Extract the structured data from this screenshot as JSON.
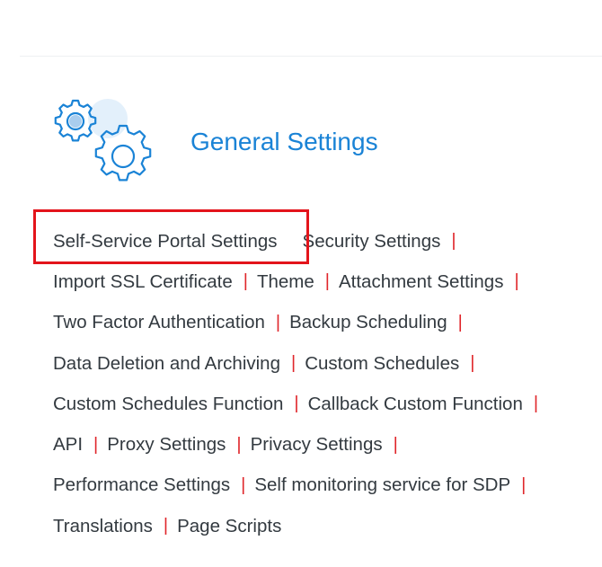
{
  "header": {
    "title": "General Settings",
    "icon": "gears-icon",
    "accent_color": "#1a83d6"
  },
  "highlight_color": "#e3141b",
  "separator": "|",
  "rows": [
    {
      "items": [
        {
          "label": "Self-Service Portal Settings",
          "name": "link-self-service-portal-settings",
          "sep": false
        },
        {
          "label": "Security Settings",
          "name": "link-security-settings",
          "sep": true
        }
      ]
    },
    {
      "items": [
        {
          "label": "Import SSL Certificate",
          "name": "link-import-ssl-certificate",
          "sep": true
        },
        {
          "label": "Theme",
          "name": "link-theme",
          "sep": true
        },
        {
          "label": "Attachment Settings",
          "name": "link-attachment-settings",
          "sep": true
        }
      ]
    },
    {
      "items": [
        {
          "label": "Two Factor Authentication",
          "name": "link-two-factor-authentication",
          "sep": true
        },
        {
          "label": "Backup Scheduling",
          "name": "link-backup-scheduling",
          "sep": true
        }
      ]
    },
    {
      "items": [
        {
          "label": "Data Deletion and Archiving",
          "name": "link-data-deletion-and-archiving",
          "sep": true
        },
        {
          "label": "Custom Schedules",
          "name": "link-custom-schedules",
          "sep": true
        }
      ]
    },
    {
      "items": [
        {
          "label": "Custom Schedules Function",
          "name": "link-custom-schedules-function",
          "sep": true
        },
        {
          "label": "Callback Custom Function",
          "name": "link-callback-custom-function",
          "sep": true
        }
      ]
    },
    {
      "items": [
        {
          "label": "API",
          "name": "link-api",
          "sep": true
        },
        {
          "label": "Proxy Settings",
          "name": "link-proxy-settings",
          "sep": true
        },
        {
          "label": "Privacy Settings",
          "name": "link-privacy-settings",
          "sep": true
        }
      ]
    },
    {
      "items": [
        {
          "label": "Performance Settings",
          "name": "link-performance-settings",
          "sep": true
        },
        {
          "label": "Self monitoring service for SDP",
          "name": "link-self-monitoring-service-for-sdp",
          "sep": true
        }
      ]
    },
    {
      "items": [
        {
          "label": "Translations",
          "name": "link-translations",
          "sep": true
        },
        {
          "label": "Page Scripts",
          "name": "link-page-scripts",
          "sep": false
        }
      ]
    }
  ]
}
